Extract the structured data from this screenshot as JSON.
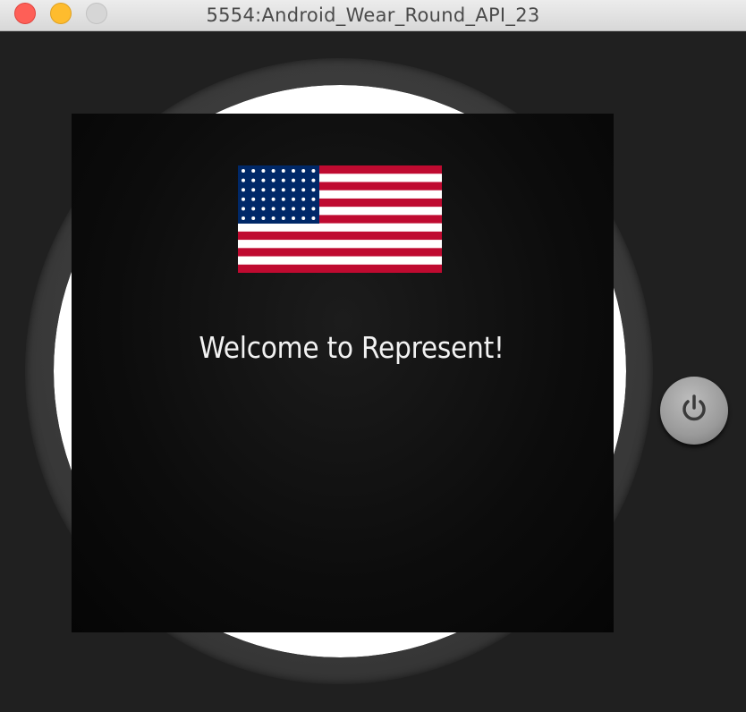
{
  "window": {
    "title": "5554:Android_Wear_Round_API_23",
    "controls": {
      "close": {
        "icon": "close-icon",
        "color": "#fe5f57"
      },
      "minimize": {
        "icon": "minimize-icon",
        "color": "#febc2e"
      },
      "zoom": {
        "icon": "zoom-icon",
        "color": "#d6d6d6"
      }
    }
  },
  "watch": {
    "flag_image": "us-flag-icon",
    "welcome_text": "Welcome to Represent!",
    "power_button": {
      "icon": "power-icon"
    }
  },
  "colors": {
    "flag_red": "#bf0a30",
    "flag_blue": "#002868",
    "flag_white": "#ffffff",
    "text": "#f2f2f2"
  }
}
